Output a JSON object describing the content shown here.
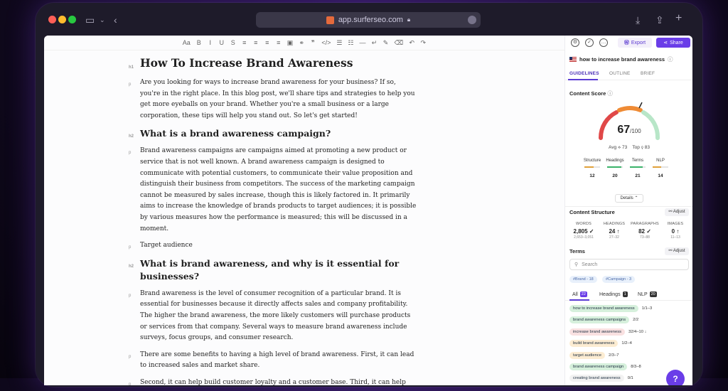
{
  "browser": {
    "url": "app.surferseo.com"
  },
  "toolbar": {
    "items": [
      "Aa",
      "B",
      "I",
      "U",
      "S",
      "≡",
      "≡",
      "≡",
      "≡",
      "▣",
      "⚭",
      "❞",
      "</>",
      "☰",
      "☷",
      "—",
      "↵",
      "✎",
      "⌫",
      "↶",
      "↷"
    ]
  },
  "document": {
    "blocks": [
      {
        "tag": "h1",
        "type": "h1",
        "text": "How To Increase Brand Awareness"
      },
      {
        "tag": "p",
        "type": "p",
        "text": "Are you looking for ways to increase brand awareness for your business? If so, you're in the right place. In this blog post, we'll share tips and strategies to help you get more eyeballs on your brand. Whether you're a small business or a large corporation, these tips will help you stand out. So let's get started!"
      },
      {
        "tag": "h2",
        "type": "h2",
        "text": "What is a brand awareness campaign?"
      },
      {
        "tag": "p",
        "type": "p",
        "text": "Brand awareness campaigns are campaigns aimed at promoting a new product or service that is not well known. A brand awareness campaign is designed to communicate with potential customers, to communicate their value proposition and distinguish their business from competitors. The success of the marketing campaign cannot be measured by sales increase, though this is likely factored in. It primarily aims to increase the knowledge of brands products to target audiences; it is possible by various measures how the performance is measured; this will be discussed in a moment."
      },
      {
        "tag": "p",
        "type": "p",
        "text": "Target audience"
      },
      {
        "tag": "h2",
        "type": "h2",
        "text": "What is brand awareness, and why is it essential for businesses?"
      },
      {
        "tag": "p",
        "type": "p",
        "text": "Brand awareness is the level of consumer recognition of a particular brand. It is essential for businesses because it directly affects sales and company profitability. The higher the brand awareness, the more likely customers will purchase products or services from that company. Several ways to measure brand awareness include surveys, focus groups, and consumer research."
      },
      {
        "tag": "p",
        "type": "p",
        "text": "There are some benefits to having a high level of brand awareness. First, it can lead to increased sales and market share."
      },
      {
        "tag": "p",
        "type": "p",
        "text": "Second, it can help build customer loyalty and a customer base. Third, it can help create positive social associations with the company and its products or services."
      }
    ]
  },
  "sidebar": {
    "export_label": "Export",
    "share_label": "Share",
    "keyword": "how to increase brand awareness",
    "tabs": [
      "GUIDELINES",
      "OUTLINE",
      "BRIEF"
    ],
    "content_score_title": "Content Score",
    "score": "67",
    "score_max": "/100",
    "score_value": 67,
    "avg_label": "Avg",
    "avg_value": "73",
    "top_label": "Top",
    "top_value": "83",
    "metrics": [
      {
        "label": "Structure",
        "value": "12",
        "color": "#e0a13a",
        "fill": 0.6
      },
      {
        "label": "Headings",
        "value": "20",
        "color": "#3bb36a",
        "fill": 0.9
      },
      {
        "label": "Terms",
        "value": "21",
        "color": "#3bb36a",
        "fill": 0.8
      },
      {
        "label": "NLP",
        "value": "14",
        "color": "#e0a13a",
        "fill": 0.55
      }
    ],
    "details_label": "Details",
    "content_structure_title": "Content Structure",
    "adjust_label": "Adjust",
    "stats": [
      {
        "label": "WORDS",
        "value": "2,805",
        "mark": "✓",
        "range": "2,653–3,051"
      },
      {
        "label": "HEADINGS",
        "value": "24",
        "mark": "↑",
        "range": "27–32"
      },
      {
        "label": "PARAGRAPHS",
        "value": "82",
        "mark": "✓",
        "range": "73–88"
      },
      {
        "label": "IMAGES",
        "value": "0",
        "mark": "↑",
        "range": "11–13"
      }
    ],
    "terms_title": "Terms",
    "search_placeholder": "Search",
    "chips": [
      "#Brand - 18",
      "#Campaign - 3"
    ],
    "term_tabs": [
      {
        "label": "All",
        "count": "22",
        "color": "#6a3de8"
      },
      {
        "label": "Headings",
        "count": "1",
        "color": "#333333"
      },
      {
        "label": "NLP",
        "count": "20",
        "color": "#333333"
      }
    ],
    "terms": [
      {
        "text": "how to increase brand awareness",
        "count": "1/1–3",
        "color": "#d6f0dc"
      },
      {
        "text": "brand awareness campaigns",
        "count": "2/2",
        "color": "#d6f0dc"
      },
      {
        "text": "increase brand awareness",
        "count": "32/4–10 ↓",
        "color": "#f9e1e1"
      },
      {
        "text": "build brand awareness",
        "count": "1/2–4",
        "color": "#fcecd2"
      },
      {
        "text": "target audience",
        "count": "2/3–7",
        "color": "#fcecd2"
      },
      {
        "text": "brand awareness campaign",
        "count": "8/3–8",
        "color": "#d6f0dc"
      },
      {
        "text": "creating brand awareness",
        "count": "0/1",
        "color": "#f2f2f2"
      }
    ],
    "help_label": "?"
  }
}
